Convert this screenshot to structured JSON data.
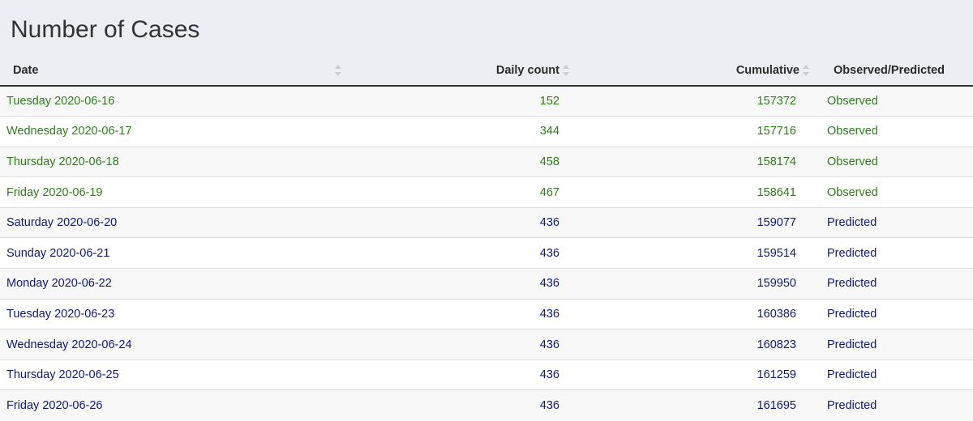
{
  "title": "Number of Cases",
  "colors": {
    "observed": "#2e7d1b",
    "predicted": "#0f1a78",
    "header_bg": "#eceef3"
  },
  "columns": {
    "date": "Date",
    "daily": "Daily count",
    "cumulative": "Cumulative",
    "status": "Observed/Predicted"
  },
  "rows": [
    {
      "date": "Tuesday 2020-06-16",
      "daily": "152",
      "cumulative": "157372",
      "status": "Observed"
    },
    {
      "date": "Wednesday 2020-06-17",
      "daily": "344",
      "cumulative": "157716",
      "status": "Observed"
    },
    {
      "date": "Thursday 2020-06-18",
      "daily": "458",
      "cumulative": "158174",
      "status": "Observed"
    },
    {
      "date": "Friday 2020-06-19",
      "daily": "467",
      "cumulative": "158641",
      "status": "Observed"
    },
    {
      "date": "Saturday 2020-06-20",
      "daily": "436",
      "cumulative": "159077",
      "status": "Predicted"
    },
    {
      "date": "Sunday 2020-06-21",
      "daily": "436",
      "cumulative": "159514",
      "status": "Predicted"
    },
    {
      "date": "Monday 2020-06-22",
      "daily": "436",
      "cumulative": "159950",
      "status": "Predicted"
    },
    {
      "date": "Tuesday 2020-06-23",
      "daily": "436",
      "cumulative": "160386",
      "status": "Predicted"
    },
    {
      "date": "Wednesday 2020-06-24",
      "daily": "436",
      "cumulative": "160823",
      "status": "Predicted"
    },
    {
      "date": "Thursday 2020-06-25",
      "daily": "436",
      "cumulative": "161259",
      "status": "Predicted"
    },
    {
      "date": "Friday 2020-06-26",
      "daily": "436",
      "cumulative": "161695",
      "status": "Predicted"
    }
  ]
}
